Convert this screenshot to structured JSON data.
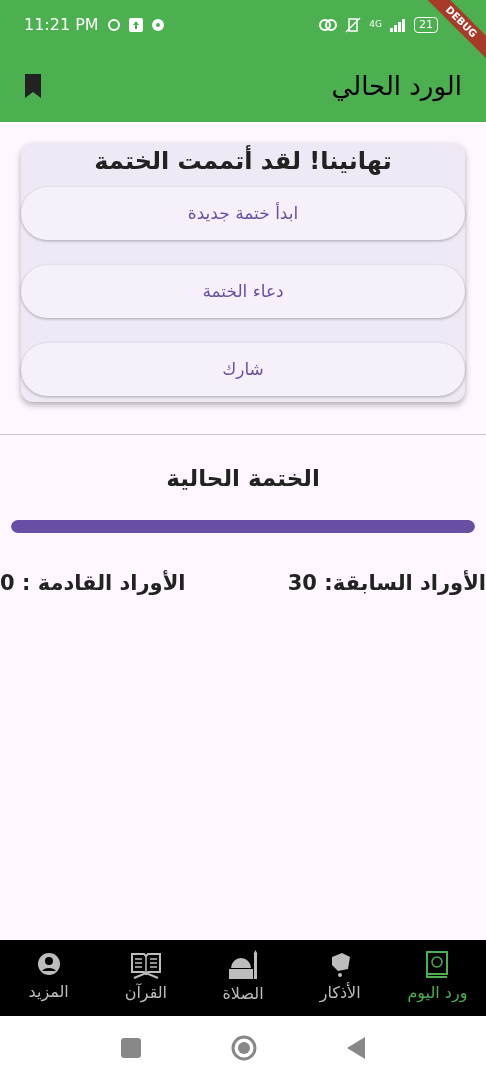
{
  "status_bar": {
    "time": "11:21 PM",
    "network": "4G",
    "battery": "21",
    "debug_banner": "DEBUG"
  },
  "app_bar": {
    "title": "الورد الحالي"
  },
  "completion_card": {
    "title": "تهانينا! لقد أتممت الختمة",
    "buttons": [
      "ابدأ ختمة جديدة",
      "دعاء الختمة",
      "شارك"
    ]
  },
  "current_khatma": {
    "title": "الختمة الحالية",
    "level": 1,
    "previous": "الأوراد السابقة: 30",
    "upcoming": "الأوراد القادمة : 0"
  },
  "bottom_nav": [
    {
      "label": "ورد اليوم",
      "kind": "book",
      "selected": true
    },
    {
      "label": "الأذكار",
      "kind": "beads",
      "selected": false
    },
    {
      "label": "الصلاة",
      "kind": "mosque",
      "selected": false
    },
    {
      "label": "القرآن",
      "kind": "quran",
      "selected": false
    },
    {
      "label": "المزيد",
      "kind": "person",
      "selected": false
    }
  ]
}
